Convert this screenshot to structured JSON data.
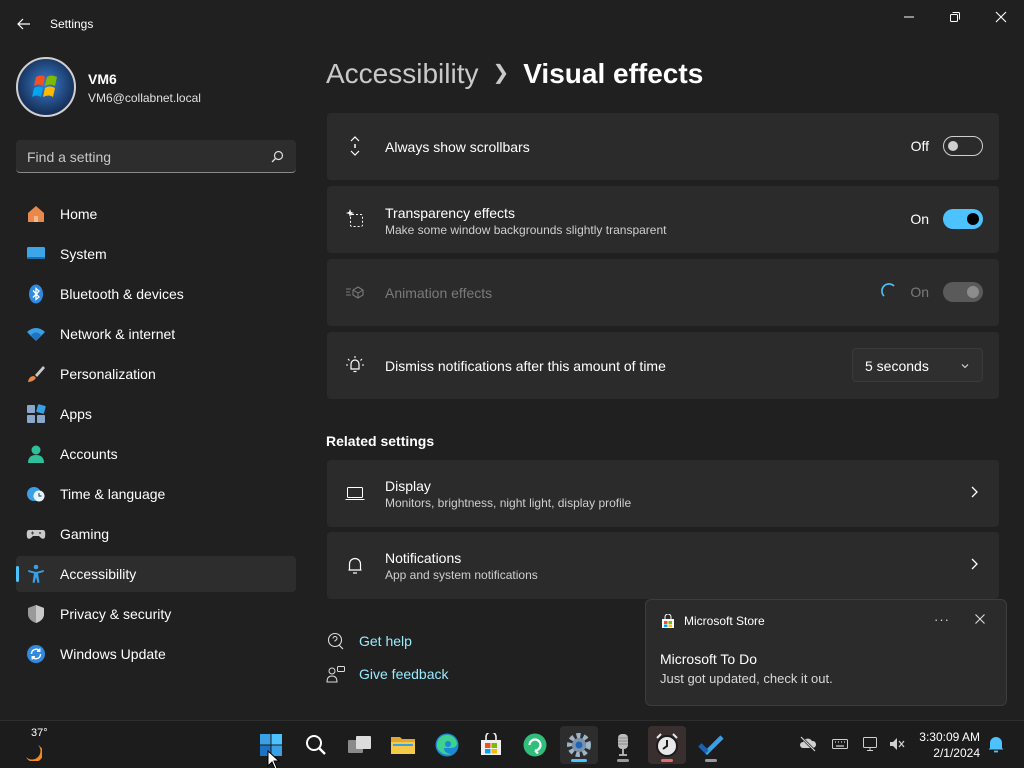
{
  "window": {
    "title": "Settings"
  },
  "user": {
    "name": "VM6",
    "email": "VM6@collabnet.local"
  },
  "search": {
    "placeholder": "Find a setting"
  },
  "nav": [
    {
      "label": "Home",
      "icon": "home-icon"
    },
    {
      "label": "System",
      "icon": "system-icon"
    },
    {
      "label": "Bluetooth & devices",
      "icon": "bluetooth-icon"
    },
    {
      "label": "Network & internet",
      "icon": "wifi-icon"
    },
    {
      "label": "Personalization",
      "icon": "brush-icon"
    },
    {
      "label": "Apps",
      "icon": "apps-icon"
    },
    {
      "label": "Accounts",
      "icon": "person-icon"
    },
    {
      "label": "Time & language",
      "icon": "clock-globe-icon"
    },
    {
      "label": "Gaming",
      "icon": "gamepad-icon"
    },
    {
      "label": "Accessibility",
      "icon": "accessibility-icon",
      "active": true
    },
    {
      "label": "Privacy & security",
      "icon": "shield-icon"
    },
    {
      "label": "Windows Update",
      "icon": "update-icon"
    }
  ],
  "breadcrumb": {
    "parent": "Accessibility",
    "current": "Visual effects"
  },
  "settings": {
    "scrollbars": {
      "title": "Always show scrollbars",
      "state": "Off"
    },
    "transparency": {
      "title": "Transparency effects",
      "subtitle": "Make some window backgrounds slightly transparent",
      "state": "On"
    },
    "animation": {
      "title": "Animation effects",
      "state": "On"
    },
    "notifications_timeout": {
      "title": "Dismiss notifications after this amount of time",
      "value": "5 seconds"
    }
  },
  "related": {
    "heading": "Related settings",
    "display": {
      "title": "Display",
      "subtitle": "Monitors, brightness, night light, display profile"
    },
    "notifications": {
      "title": "Notifications",
      "subtitle": "App and system notifications"
    }
  },
  "links": {
    "help": "Get help",
    "feedback": "Give feedback"
  },
  "toast": {
    "app": "Microsoft Store",
    "title": "Microsoft To Do",
    "body": "Just got updated, check it out.",
    "more": "···"
  },
  "taskbar": {
    "weather_temp": "37°",
    "time": "3:30:09 AM",
    "date": "2/1/2024"
  },
  "colors": {
    "accent": "#4cc2ff",
    "background": "#202020",
    "card": "#2b2b2b",
    "link": "#99ebff"
  }
}
